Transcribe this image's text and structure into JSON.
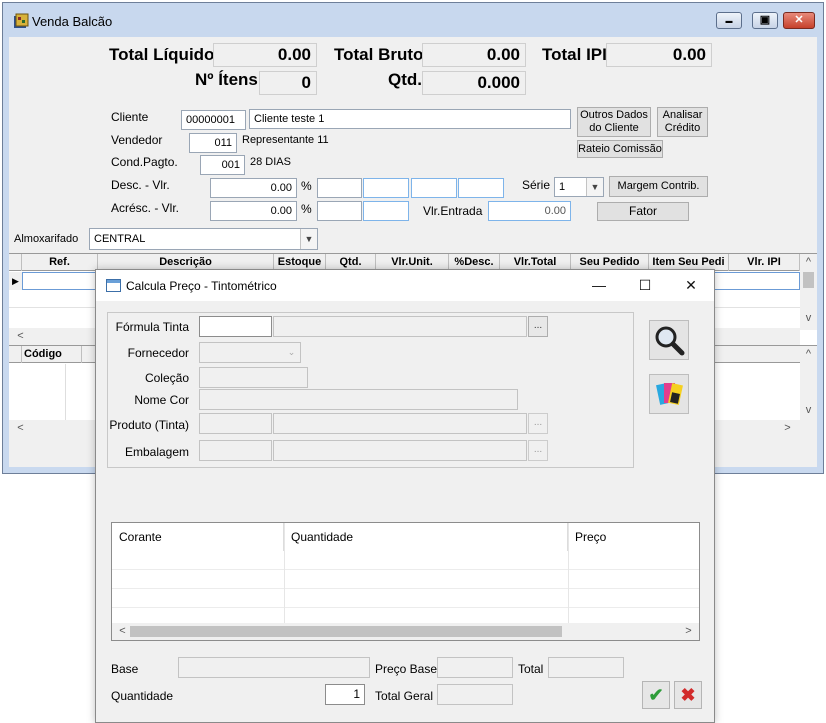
{
  "back_window": {
    "title": "Venda Balcão",
    "title_buttons": {
      "minimize": "▬",
      "maximize": "▣",
      "close": "✕"
    },
    "totals": {
      "total_liquido_label": "Total Líquido",
      "total_liquido_value": "0.00",
      "total_bruto_label": "Total Bruto",
      "total_bruto_value": "0.00",
      "total_ipi_label": "Total IPI",
      "total_ipi_value": "0.00",
      "n_itens_label": "Nº Ítens",
      "n_itens_value": "0",
      "qtd_label": "Qtd.",
      "qtd_value": "0.000"
    },
    "form": {
      "cliente_label": "Cliente",
      "cliente_code": "00000001",
      "cliente_name": "Cliente teste 1",
      "vendedor_label": "Vendedor",
      "vendedor_code": "011",
      "vendedor_name": "Representante 11",
      "cond_pagto_label": "Cond.Pagto.",
      "cond_pagto_code": "001",
      "cond_pagto_name": "28 DIAS",
      "desc_label": "Desc. - Vlr.",
      "desc_value": "0.00",
      "acresc_label": "Acrésc. - Vlr.",
      "acresc_value": "0.00",
      "percent_symbol": "%",
      "serie_label": "Série",
      "serie_value": "1",
      "vlr_entrada_label": "Vlr.Entrada",
      "vlr_entrada_value": "0.00",
      "almoxarifado_label": "Almoxarifado",
      "almoxarifado_value": "CENTRAL"
    },
    "buttons": {
      "outros_dados": "Outros Dados do Cliente",
      "analisar_credito": "Analisar Crédito",
      "rateio_comissao": "Rateio Comissão",
      "margem_contrib": "Margem Contrib.",
      "fator": "Fator"
    },
    "items_grid": {
      "columns": [
        "Ref.",
        "Descrição",
        "Estoque",
        "Qtd.",
        "Vlr.Unit.",
        "%Desc.",
        "Vlr.Total",
        "Seu Pedido",
        "Item Seu Pedi",
        "Vlr. IPI"
      ]
    },
    "lower_grid": {
      "columns": [
        "Código"
      ]
    },
    "scroll_glyphs": {
      "left": "<",
      "right": ">",
      "up": "^",
      "down": "v"
    }
  },
  "dialog": {
    "title": "Calcula Preço - Tintométrico",
    "title_buttons": {
      "minimize": "—",
      "maximize": "☐",
      "close": "✕"
    },
    "labels": {
      "formula_tinta": "Fórmula Tinta",
      "fornecedor": "Fornecedor",
      "colecao": "Coleção",
      "nome_cor": "Nome Cor",
      "produto_tinta": "Produto (Tinta)",
      "embalagem": "Embalagem"
    },
    "ellipsis": "...",
    "corante_grid": {
      "columns": [
        "Corante",
        "Quantidade",
        "Preço"
      ]
    },
    "footer": {
      "base_label": "Base",
      "preco_base_label": "Preço Base",
      "total_label": "Total",
      "quantidade_label": "Quantidade",
      "quantidade_value": "1",
      "total_geral_label": "Total Geral"
    },
    "icons": {
      "search": "search-icon",
      "palette": "color-palette-icon",
      "ok": "check-icon",
      "cancel": "x-icon"
    },
    "ok_glyph": "✔",
    "cancel_glyph": "✖"
  }
}
